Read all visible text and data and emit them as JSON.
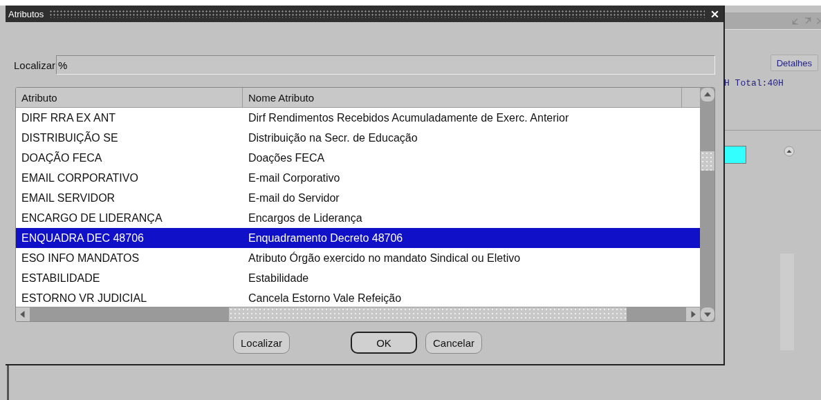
{
  "background_window": {
    "detail_button": "Detalhes",
    "summary_text": "H Total:40H"
  },
  "dialog": {
    "title": "Atributos",
    "search": {
      "label": "Localizar",
      "value": "%"
    },
    "table": {
      "columns": [
        "Atributo",
        "Nome Atributo"
      ],
      "rows": [
        {
          "cells": [
            "DIRF RRA EX ANT",
            "Dirf Rendimentos Recebidos Acumuladamente de Exerc. Anterior"
          ],
          "selected": false
        },
        {
          "cells": [
            "DISTRIBUIÇÃO SE",
            "Distribuição na Secr. de Educação"
          ],
          "selected": false
        },
        {
          "cells": [
            "DOAÇÃO FECA",
            "Doações FECA"
          ],
          "selected": false
        },
        {
          "cells": [
            "EMAIL CORPORATIVO",
            "E-mail Corporativo"
          ],
          "selected": false
        },
        {
          "cells": [
            "EMAIL SERVIDOR",
            "E-mail do Servidor"
          ],
          "selected": false
        },
        {
          "cells": [
            "ENCARGO DE LIDERANÇA",
            "Encargos de Liderança"
          ],
          "selected": false
        },
        {
          "cells": [
            "ENQUADRA DEC 48706",
            "Enquadramento Decreto 48706"
          ],
          "selected": true
        },
        {
          "cells": [
            "ESO INFO MANDATOS",
            "Atributo Órgão exercido no mandato Sindical ou Eletivo"
          ],
          "selected": false
        },
        {
          "cells": [
            "ESTABILIDADE",
            "Estabilidade"
          ],
          "selected": false
        },
        {
          "cells": [
            "ESTORNO VR JUDICIAL",
            "Cancela Estorno Vale Refeição"
          ],
          "selected": false
        }
      ]
    },
    "buttons": [
      {
        "label": "Localizar",
        "default": false
      },
      {
        "label": "OK",
        "default": true
      },
      {
        "label": "Cancelar",
        "default": false
      }
    ]
  }
}
